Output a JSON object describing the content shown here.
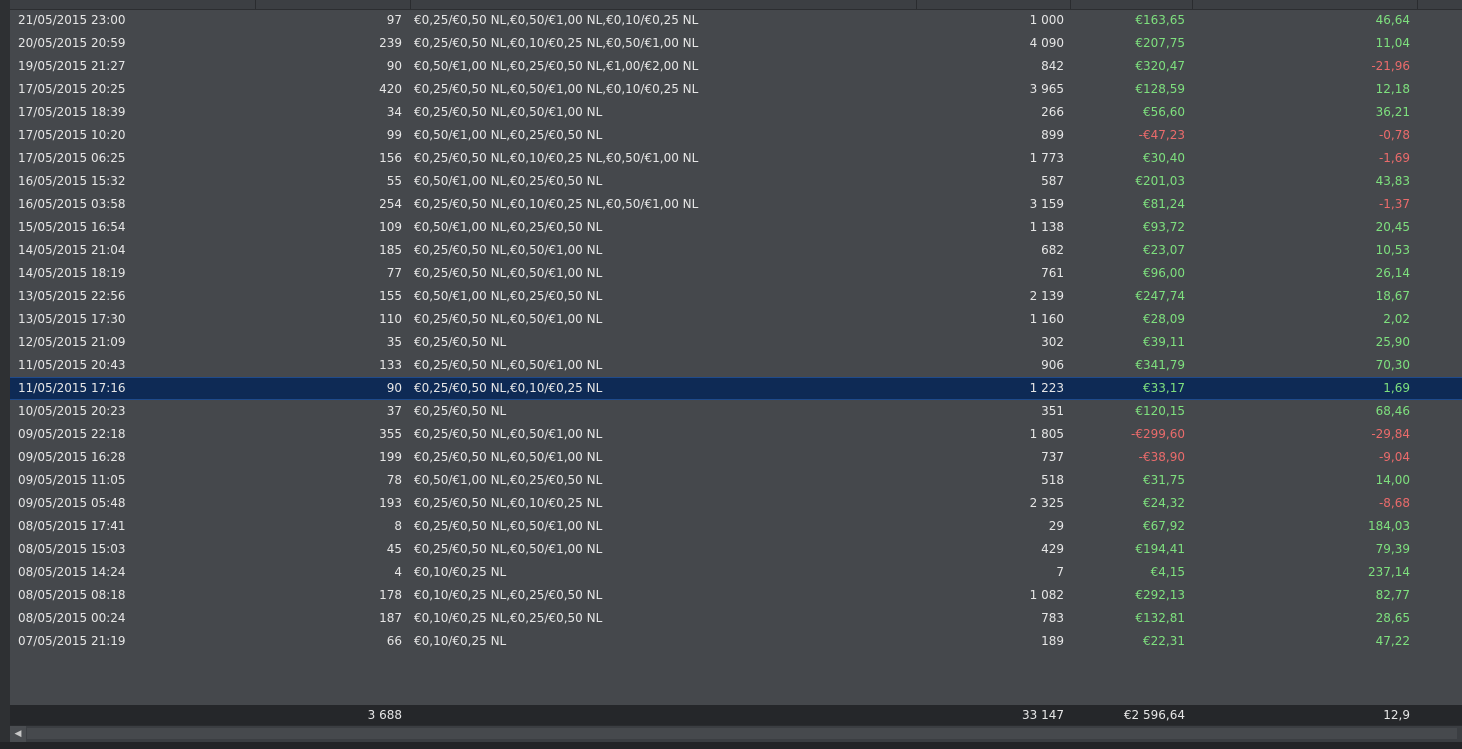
{
  "table": {
    "rows": [
      {
        "date": "21/05/2015 23:00",
        "hands": "97",
        "stakes": "€0,25/€0,50 NL,€0,50/€1,00 NL,€0,10/€0,25 NL",
        "count": "1 000",
        "amount": "€163,65",
        "rate": "46,64",
        "amount_sign": "pos",
        "rate_sign": "pos"
      },
      {
        "date": "20/05/2015 20:59",
        "hands": "239",
        "stakes": "€0,25/€0,50 NL,€0,10/€0,25 NL,€0,50/€1,00 NL",
        "count": "4 090",
        "amount": "€207,75",
        "rate": "11,04",
        "amount_sign": "pos",
        "rate_sign": "pos"
      },
      {
        "date": "19/05/2015 21:27",
        "hands": "90",
        "stakes": "€0,50/€1,00 NL,€0,25/€0,50 NL,€1,00/€2,00 NL",
        "count": "842",
        "amount": "€320,47",
        "rate": "-21,96",
        "amount_sign": "pos",
        "rate_sign": "neg"
      },
      {
        "date": "17/05/2015 20:25",
        "hands": "420",
        "stakes": "€0,25/€0,50 NL,€0,50/€1,00 NL,€0,10/€0,25 NL",
        "count": "3 965",
        "amount": "€128,59",
        "rate": "12,18",
        "amount_sign": "pos",
        "rate_sign": "pos"
      },
      {
        "date": "17/05/2015 18:39",
        "hands": "34",
        "stakes": "€0,25/€0,50 NL,€0,50/€1,00 NL",
        "count": "266",
        "amount": "€56,60",
        "rate": "36,21",
        "amount_sign": "pos",
        "rate_sign": "pos"
      },
      {
        "date": "17/05/2015 10:20",
        "hands": "99",
        "stakes": "€0,50/€1,00 NL,€0,25/€0,50 NL",
        "count": "899",
        "amount": "-€47,23",
        "rate": "-0,78",
        "amount_sign": "neg",
        "rate_sign": "neg"
      },
      {
        "date": "17/05/2015 06:25",
        "hands": "156",
        "stakes": "€0,25/€0,50 NL,€0,10/€0,25 NL,€0,50/€1,00 NL",
        "count": "1 773",
        "amount": "€30,40",
        "rate": "-1,69",
        "amount_sign": "pos",
        "rate_sign": "neg"
      },
      {
        "date": "16/05/2015 15:32",
        "hands": "55",
        "stakes": "€0,50/€1,00 NL,€0,25/€0,50 NL",
        "count": "587",
        "amount": "€201,03",
        "rate": "43,83",
        "amount_sign": "pos",
        "rate_sign": "pos"
      },
      {
        "date": "16/05/2015 03:58",
        "hands": "254",
        "stakes": "€0,25/€0,50 NL,€0,10/€0,25 NL,€0,50/€1,00 NL",
        "count": "3 159",
        "amount": "€81,24",
        "rate": "-1,37",
        "amount_sign": "pos",
        "rate_sign": "neg"
      },
      {
        "date": "15/05/2015 16:54",
        "hands": "109",
        "stakes": "€0,50/€1,00 NL,€0,25/€0,50 NL",
        "count": "1 138",
        "amount": "€93,72",
        "rate": "20,45",
        "amount_sign": "pos",
        "rate_sign": "pos"
      },
      {
        "date": "14/05/2015 21:04",
        "hands": "185",
        "stakes": "€0,25/€0,50 NL,€0,50/€1,00 NL",
        "count": "682",
        "amount": "€23,07",
        "rate": "10,53",
        "amount_sign": "pos",
        "rate_sign": "pos"
      },
      {
        "date": "14/05/2015 18:19",
        "hands": "77",
        "stakes": "€0,25/€0,50 NL,€0,50/€1,00 NL",
        "count": "761",
        "amount": "€96,00",
        "rate": "26,14",
        "amount_sign": "pos",
        "rate_sign": "pos"
      },
      {
        "date": "13/05/2015 22:56",
        "hands": "155",
        "stakes": "€0,50/€1,00 NL,€0,25/€0,50 NL",
        "count": "2 139",
        "amount": "€247,74",
        "rate": "18,67",
        "amount_sign": "pos",
        "rate_sign": "pos"
      },
      {
        "date": "13/05/2015 17:30",
        "hands": "110",
        "stakes": "€0,25/€0,50 NL,€0,50/€1,00 NL",
        "count": "1 160",
        "amount": "€28,09",
        "rate": "2,02",
        "amount_sign": "pos",
        "rate_sign": "pos"
      },
      {
        "date": "12/05/2015 21:09",
        "hands": "35",
        "stakes": "€0,25/€0,50 NL",
        "count": "302",
        "amount": "€39,11",
        "rate": "25,90",
        "amount_sign": "pos",
        "rate_sign": "pos"
      },
      {
        "date": "11/05/2015 20:43",
        "hands": "133",
        "stakes": "€0,25/€0,50 NL,€0,50/€1,00 NL",
        "count": "906",
        "amount": "€341,79",
        "rate": "70,30",
        "amount_sign": "pos",
        "rate_sign": "pos"
      },
      {
        "date": "11/05/2015 17:16",
        "hands": "90",
        "stakes": "€0,25/€0,50 NL,€0,10/€0,25 NL",
        "count": "1 223",
        "amount": "€33,17",
        "rate": "1,69",
        "amount_sign": "pos",
        "rate_sign": "pos",
        "selected": true
      },
      {
        "date": "10/05/2015 20:23",
        "hands": "37",
        "stakes": "€0,25/€0,50 NL",
        "count": "351",
        "amount": "€120,15",
        "rate": "68,46",
        "amount_sign": "pos",
        "rate_sign": "pos"
      },
      {
        "date": "09/05/2015 22:18",
        "hands": "355",
        "stakes": "€0,25/€0,50 NL,€0,50/€1,00 NL",
        "count": "1 805",
        "amount": "-€299,60",
        "rate": "-29,84",
        "amount_sign": "neg",
        "rate_sign": "neg"
      },
      {
        "date": "09/05/2015 16:28",
        "hands": "199",
        "stakes": "€0,25/€0,50 NL,€0,50/€1,00 NL",
        "count": "737",
        "amount": "-€38,90",
        "rate": "-9,04",
        "amount_sign": "neg",
        "rate_sign": "neg"
      },
      {
        "date": "09/05/2015 11:05",
        "hands": "78",
        "stakes": "€0,50/€1,00 NL,€0,25/€0,50 NL",
        "count": "518",
        "amount": "€31,75",
        "rate": "14,00",
        "amount_sign": "pos",
        "rate_sign": "pos"
      },
      {
        "date": "09/05/2015 05:48",
        "hands": "193",
        "stakes": "€0,25/€0,50 NL,€0,10/€0,25 NL",
        "count": "2 325",
        "amount": "€24,32",
        "rate": "-8,68",
        "amount_sign": "pos",
        "rate_sign": "neg"
      },
      {
        "date": "08/05/2015 17:41",
        "hands": "8",
        "stakes": "€0,25/€0,50 NL,€0,50/€1,00 NL",
        "count": "29",
        "amount": "€67,92",
        "rate": "184,03",
        "amount_sign": "pos",
        "rate_sign": "pos"
      },
      {
        "date": "08/05/2015 15:03",
        "hands": "45",
        "stakes": "€0,25/€0,50 NL,€0,50/€1,00 NL",
        "count": "429",
        "amount": "€194,41",
        "rate": "79,39",
        "amount_sign": "pos",
        "rate_sign": "pos"
      },
      {
        "date": "08/05/2015 14:24",
        "hands": "4",
        "stakes": "€0,10/€0,25 NL",
        "count": "7",
        "amount": "€4,15",
        "rate": "237,14",
        "amount_sign": "pos",
        "rate_sign": "pos"
      },
      {
        "date": "08/05/2015 08:18",
        "hands": "178",
        "stakes": "€0,10/€0,25 NL,€0,25/€0,50 NL",
        "count": "1 082",
        "amount": "€292,13",
        "rate": "82,77",
        "amount_sign": "pos",
        "rate_sign": "pos"
      },
      {
        "date": "08/05/2015 00:24",
        "hands": "187",
        "stakes": "€0,10/€0,25 NL,€0,25/€0,50 NL",
        "count": "783",
        "amount": "€132,81",
        "rate": "28,65",
        "amount_sign": "pos",
        "rate_sign": "pos"
      },
      {
        "date": "07/05/2015 21:19",
        "hands": "66",
        "stakes": "€0,10/€0,25 NL",
        "count": "189",
        "amount": "€22,31",
        "rate": "47,22",
        "amount_sign": "pos",
        "rate_sign": "pos"
      }
    ],
    "totals": {
      "hands": "3 688",
      "count": "33 147",
      "amount": "€2 596,64",
      "rate": "12,9"
    }
  },
  "colors": {
    "positive": "#7ee07e",
    "negative": "#ea6b6b",
    "selected": "#0e2a55"
  },
  "scrollbar": {
    "left_arrow_icon": "chevron-left-icon",
    "glyph": "◀"
  }
}
